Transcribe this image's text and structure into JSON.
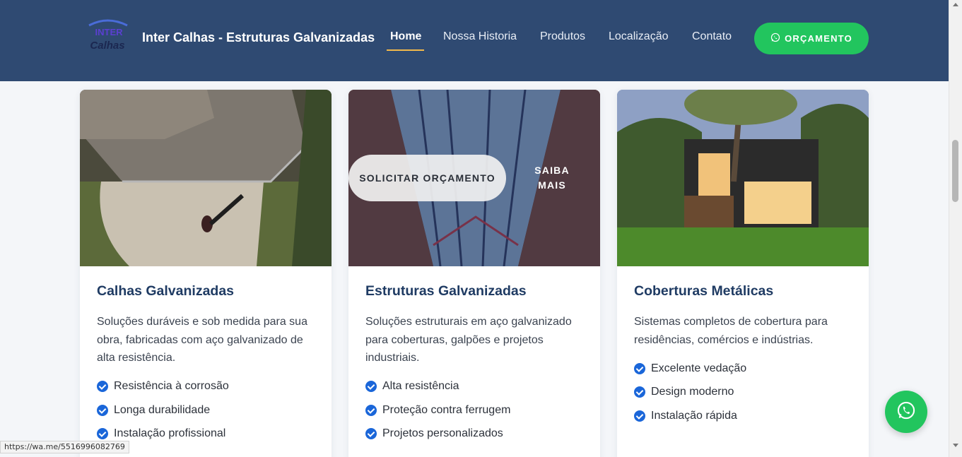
{
  "header": {
    "brand": "Inter Calhas - Estruturas Galvanizadas",
    "logo_text_top": "INTER",
    "logo_text_bottom": "Calhas",
    "nav": [
      "Home",
      "Nossa Historia",
      "Produtos",
      "Localização",
      "Contato"
    ],
    "active_nav": "Home",
    "cta_label": "ORÇAMENTO",
    "cta_icon": "whatsapp-icon",
    "accent_color": "#f2b84b",
    "header_color": "#2f4a72",
    "cta_color": "#22c55e"
  },
  "cards": [
    {
      "title": "Calhas Galvanizadas",
      "description": "Soluções duráveis e sob medida para sua obra, fabricadas com aço galvanizado de alta resistência.",
      "features": [
        "Resistência à corrosão",
        "Longa durabilidade",
        "Instalação profissional"
      ]
    },
    {
      "title": "Estruturas Galvanizadas",
      "description": "Soluções estruturais em aço galvanizado para coberturas, galpões e projetos industriais.",
      "features": [
        "Alta resistência",
        "Proteção contra ferrugem",
        "Projetos personalizados"
      ],
      "overlay": {
        "primary": "SOLICITAR ORÇAMENTO",
        "secondary": "SAIBA MAIS"
      }
    },
    {
      "title": "Coberturas Metálicas",
      "description": "Sistemas completos de cobertura para residências, comércios e indústrias.",
      "features": [
        "Excelente vedação",
        "Design moderno",
        "Instalação rápida"
      ]
    }
  ],
  "whatsapp_float_icon": "whatsapp-icon",
  "status_url": "https://wa.me/5516996082769"
}
